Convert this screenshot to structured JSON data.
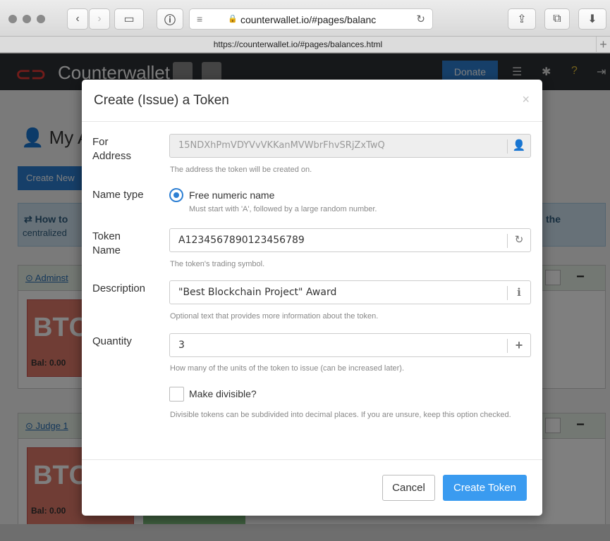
{
  "browser": {
    "url_display": "counterwallet.io/#pages/balanc",
    "url_full": "https://counterwallet.io/#pages/balances.html"
  },
  "app": {
    "brand": "Counterwallet",
    "donate": "Donate",
    "page_title": "My A",
    "create_new": "Create New",
    "howto_left": "⇄ How to",
    "howto_right": "the",
    "howto_line2": "centralized",
    "wallets": [
      {
        "name": "Adminst",
        "btc": "BTC",
        "bal": "Bal: 0.00"
      },
      {
        "name": "Judge 1",
        "btc": "BTC",
        "bal": "Bal: 0.00"
      }
    ]
  },
  "modal": {
    "title": "Create (Issue) a Token",
    "close": "×",
    "address": {
      "label": "For Address",
      "value": "15NDXhPmVDYVvVKKanMVWbrFhvSRjZxTwQ",
      "help": "The address the token will be created on."
    },
    "name_type": {
      "label": "Name type",
      "option": "Free numeric name",
      "help": "Must start with 'A', followed by a large random number.",
      "selected": true
    },
    "token_name": {
      "label": "Token Name",
      "value": "A1234567890123456789",
      "help": "The token's trading symbol."
    },
    "description": {
      "label": "Description",
      "value": "\"Best Blockchain Project\" Award",
      "help": "Optional text that provides more information about the token."
    },
    "quantity": {
      "label": "Quantity",
      "value": "3",
      "help": "How many of the units of the token to issue (can be increased later)."
    },
    "divisible": {
      "label": "Make divisible?",
      "checked": false,
      "help": "Divisible tokens can be subdivided into decimal places. If you are unsure, keep this option checked."
    },
    "cancel": "Cancel",
    "create": "Create Token"
  },
  "colors": {
    "primary": "#3a9bf0",
    "navbar": "#2c3035",
    "logo_red": "#e53935"
  }
}
